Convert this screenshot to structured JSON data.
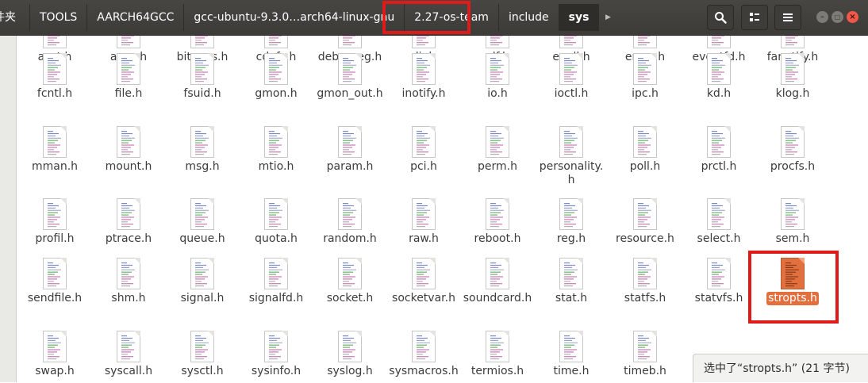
{
  "breadcrumbs": [
    {
      "label": "件夹",
      "current": false,
      "partial": true
    },
    {
      "label": "TOOLS",
      "current": false
    },
    {
      "label": "AARCH64GCC",
      "current": false
    },
    {
      "label": "gcc-ubuntu-9.3.0…arch64-linux-gnu",
      "current": false
    },
    {
      "label": "2.27-os-team",
      "current": false
    },
    {
      "label": "include",
      "current": false
    },
    {
      "label": "sys",
      "current": true
    }
  ],
  "header_icons": {
    "next": "chevron-right-icon",
    "search": "search-icon",
    "view": "grid-view-icon",
    "menu": "hamburger-menu-icon",
    "minimize": "minimize-icon",
    "maximize": "maximize-icon",
    "close": "close-icon"
  },
  "colors": {
    "header_bg": "#3c3b37",
    "selection": "#e2703e",
    "highlight_annotation": "#e01919",
    "close_button": "#f1584a"
  },
  "files": [
    {
      "name": "acct.h",
      "icon": "text-file-icon"
    },
    {
      "name": "auxv.h",
      "icon": "text-file-icon"
    },
    {
      "name": "bitypes.h",
      "icon": "text-file-icon"
    },
    {
      "name": "cdefs.h",
      "icon": "text-file-icon"
    },
    {
      "name": "debugreg.h",
      "icon": "text-file-icon"
    },
    {
      "name": "dir.h",
      "icon": "text-file-icon"
    },
    {
      "name": "elf.h",
      "icon": "text-file-icon"
    },
    {
      "name": "epoll.h",
      "icon": "text-file-icon"
    },
    {
      "name": "errno.h",
      "icon": "text-file-icon"
    },
    {
      "name": "eventfd.h",
      "icon": "text-file-icon"
    },
    {
      "name": "fanotify.h",
      "icon": "text-file-icon"
    },
    {
      "name": "fcntl.h",
      "icon": "text-file-icon"
    },
    {
      "name": "file.h",
      "icon": "text-file-icon"
    },
    {
      "name": "fsuid.h",
      "icon": "text-file-icon"
    },
    {
      "name": "gmon.h",
      "icon": "text-file-icon"
    },
    {
      "name": "gmon_out.h",
      "icon": "text-file-icon"
    },
    {
      "name": "inotify.h",
      "icon": "text-file-icon"
    },
    {
      "name": "io.h",
      "icon": "text-file-icon"
    },
    {
      "name": "ioctl.h",
      "icon": "text-file-icon"
    },
    {
      "name": "ipc.h",
      "icon": "text-file-icon"
    },
    {
      "name": "kd.h",
      "icon": "text-file-icon"
    },
    {
      "name": "klog.h",
      "icon": "text-file-icon"
    },
    {
      "name": "mman.h",
      "icon": "text-file-icon"
    },
    {
      "name": "mount.h",
      "icon": "text-file-icon"
    },
    {
      "name": "msg.h",
      "icon": "text-file-icon"
    },
    {
      "name": "mtio.h",
      "icon": "text-file-icon"
    },
    {
      "name": "param.h",
      "icon": "text-file-icon"
    },
    {
      "name": "pci.h",
      "icon": "text-file-icon"
    },
    {
      "name": "perm.h",
      "icon": "text-file-icon"
    },
    {
      "name": "personality.h",
      "icon": "text-file-icon"
    },
    {
      "name": "poll.h",
      "icon": "text-file-icon"
    },
    {
      "name": "prctl.h",
      "icon": "text-file-icon"
    },
    {
      "name": "procfs.h",
      "icon": "text-file-icon"
    },
    {
      "name": "profil.h",
      "icon": "text-file-icon"
    },
    {
      "name": "ptrace.h",
      "icon": "text-file-icon"
    },
    {
      "name": "queue.h",
      "icon": "text-file-icon"
    },
    {
      "name": "quota.h",
      "icon": "text-file-icon"
    },
    {
      "name": "random.h",
      "icon": "text-file-icon"
    },
    {
      "name": "raw.h",
      "icon": "text-file-icon"
    },
    {
      "name": "reboot.h",
      "icon": "text-file-icon"
    },
    {
      "name": "reg.h",
      "icon": "text-file-icon"
    },
    {
      "name": "resource.h",
      "icon": "text-file-icon"
    },
    {
      "name": "select.h",
      "icon": "text-file-icon"
    },
    {
      "name": "sem.h",
      "icon": "text-file-icon"
    },
    {
      "name": "sendfile.h",
      "icon": "text-file-icon"
    },
    {
      "name": "shm.h",
      "icon": "text-file-icon"
    },
    {
      "name": "signal.h",
      "icon": "text-file-icon"
    },
    {
      "name": "signalfd.h",
      "icon": "text-file-icon"
    },
    {
      "name": "socket.h",
      "icon": "text-file-icon"
    },
    {
      "name": "socketvar.h",
      "icon": "text-file-icon"
    },
    {
      "name": "soundcard.h",
      "icon": "text-file-icon"
    },
    {
      "name": "stat.h",
      "icon": "text-file-icon"
    },
    {
      "name": "statfs.h",
      "icon": "text-file-icon"
    },
    {
      "name": "statvfs.h",
      "icon": "text-file-icon"
    },
    {
      "name": "stropts.h",
      "icon": "text-file-icon",
      "selected": true
    },
    {
      "name": "swap.h",
      "icon": "text-file-icon"
    },
    {
      "name": "syscall.h",
      "icon": "text-file-icon"
    },
    {
      "name": "sysctl.h",
      "icon": "text-file-icon"
    },
    {
      "name": "sysinfo.h",
      "icon": "text-file-icon"
    },
    {
      "name": "syslog.h",
      "icon": "text-file-icon"
    },
    {
      "name": "sysmacros.h",
      "icon": "text-file-icon"
    },
    {
      "name": "termios.h",
      "icon": "text-file-icon"
    },
    {
      "name": "time.h",
      "icon": "text-file-icon"
    },
    {
      "name": "timeb.h",
      "icon": "text-file-icon"
    }
  ],
  "status_bar": {
    "text": "选中了“stropts.h” (21 字节)"
  }
}
